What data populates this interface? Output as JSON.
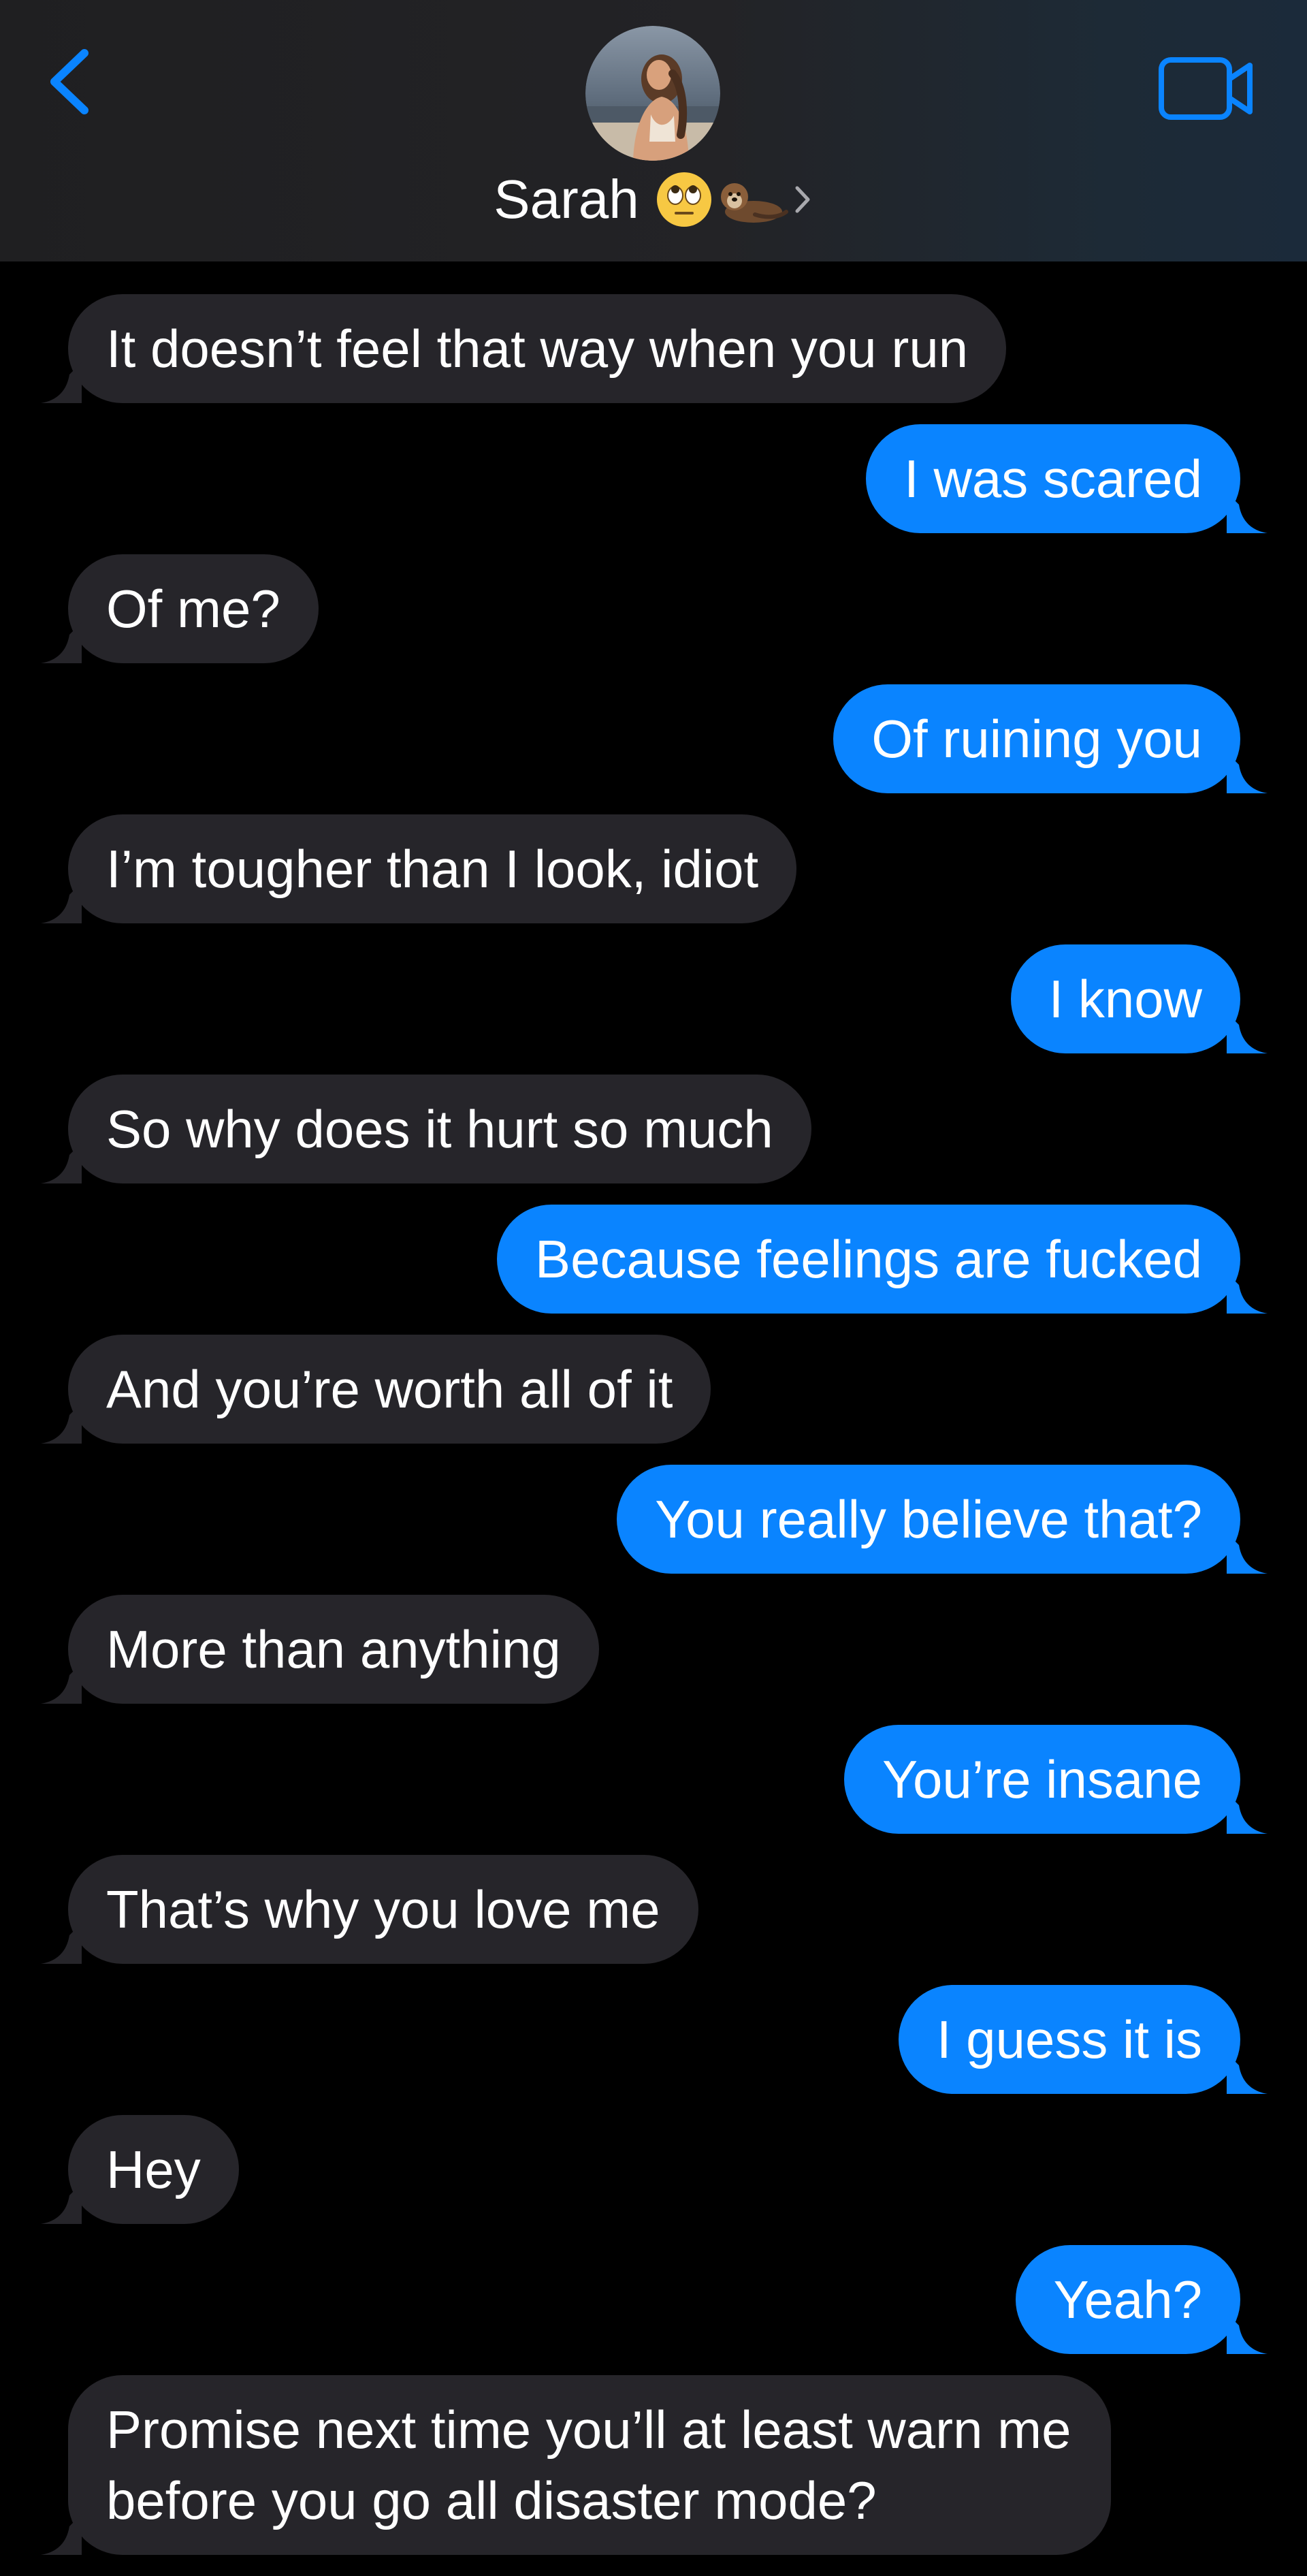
{
  "header": {
    "contact_name": "Sarah",
    "contact_emojis": [
      "face-with-rolling-eyes-emoji",
      "otter-emoji"
    ],
    "back_icon": "chevron-left-icon",
    "video_icon": "video-camera-icon",
    "accent_color": "#0a84ff"
  },
  "colors": {
    "incoming_bubble": "#26252a",
    "outgoing_bubble": "#0a84ff",
    "background": "#000000"
  },
  "messages": [
    {
      "direction": "incoming",
      "text": "It doesn’t feel that way when you run"
    },
    {
      "direction": "outgoing",
      "text": "I was scared"
    },
    {
      "direction": "incoming",
      "text": "Of me?"
    },
    {
      "direction": "outgoing",
      "text": "Of ruining you"
    },
    {
      "direction": "incoming",
      "text": "I’m tougher than I look, idiot"
    },
    {
      "direction": "outgoing",
      "text": "I know"
    },
    {
      "direction": "incoming",
      "text": "So why does it hurt so much"
    },
    {
      "direction": "outgoing",
      "text": "Because feelings are fucked"
    },
    {
      "direction": "incoming",
      "text": "And you’re worth all of it"
    },
    {
      "direction": "outgoing",
      "text": "You really believe that?"
    },
    {
      "direction": "incoming",
      "text": "More than anything"
    },
    {
      "direction": "outgoing",
      "text": "You’re insane"
    },
    {
      "direction": "incoming",
      "text": "That’s why you love me"
    },
    {
      "direction": "outgoing",
      "text": "I guess it is"
    },
    {
      "direction": "incoming",
      "text": "Hey"
    },
    {
      "direction": "outgoing",
      "text": "Yeah?"
    },
    {
      "direction": "incoming",
      "text": "Promise next time you’ll at least warn me before you go all disaster mode?"
    }
  ]
}
